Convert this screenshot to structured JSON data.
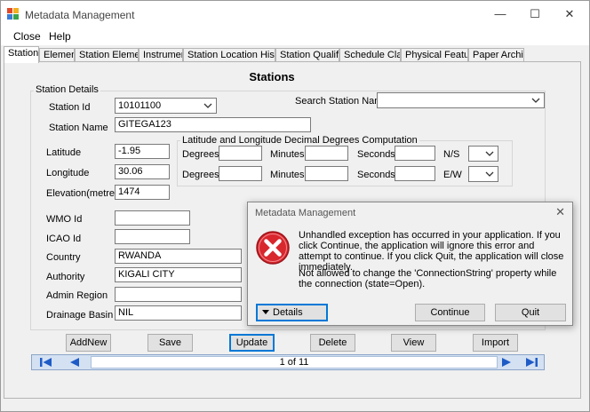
{
  "window": {
    "title": "Metadata Management",
    "controls": {
      "minimize": "—",
      "maximize": "☐",
      "close": "✕"
    }
  },
  "menu": {
    "items": [
      "Close",
      "Help"
    ]
  },
  "tabs": [
    "Station",
    "Element",
    "Station Element",
    "Instrument",
    "Station Location History",
    "Station Qualifier",
    "Schedule Class",
    "Physical Feature",
    "Paper Archive"
  ],
  "page": {
    "title": "Stations"
  },
  "station_details": {
    "group_label": "Station Details",
    "station_id_label": "Station Id",
    "station_id_value": "10101100",
    "search_label": "Search Station Name",
    "search_value": "",
    "station_name_label": "Station Name",
    "station_name_value": "GITEGA123",
    "latitude_label": "Latitude",
    "latitude_value": "-1.95",
    "longitude_label": "Longitude",
    "longitude_value": "30.06",
    "elevation_label": "Elevation(metres)",
    "elevation_value": "1474",
    "wmo_label": "WMO Id",
    "wmo_value": "",
    "icao_label": "ICAO Id",
    "icao_value": "",
    "country_label": "Country",
    "country_value": "RWANDA",
    "authority_label": "Authority",
    "authority_value": "KIGALI CITY",
    "admin_region_label": "Admin Region",
    "admin_region_value": "",
    "drainage_label": "Drainage Basin",
    "drainage_value": "NIL"
  },
  "conversion": {
    "group_label": "Latitude and Longitude Decimal Degrees Computation",
    "degrees_label": "Degrees",
    "minutes_label": "Minutes",
    "seconds_label": "Seconds",
    "ns_label": "N/S",
    "ew_label": "E/W"
  },
  "buttons": {
    "add_new": "AddNew",
    "save": "Save",
    "update": "Update",
    "delete": "Delete",
    "view": "View",
    "import": "Import"
  },
  "navigator": {
    "position_text": "1 of 11"
  },
  "dialog": {
    "title": "Metadata Management",
    "message": "Unhandled exception has occurred in your application. If you click Continue, the application will ignore this error and attempt to continue. If you click Quit, the application will close immediately.",
    "detail": "Not allowed to change the 'ConnectionString' property while the connection (state=Open).",
    "details_button": "Details",
    "continue_button": "Continue",
    "quit_button": "Quit"
  },
  "colors": {
    "accent": "#0078d7",
    "error_red": "#d9272e",
    "nav_blue": "#1e5bc6"
  }
}
